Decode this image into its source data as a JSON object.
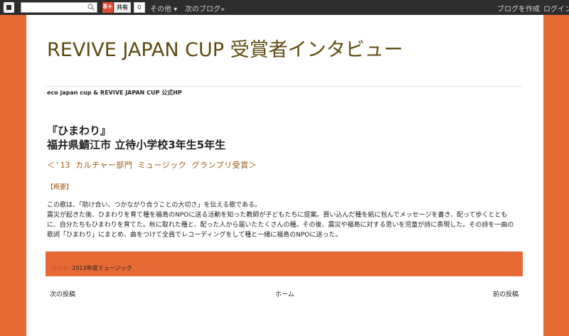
{
  "navbar": {
    "logo_icon": "blogger-icon",
    "search_icon": "search-icon",
    "gplus_label": "8+",
    "share_label": "共有",
    "share_count": "0",
    "more_label": "その他 ▾",
    "next_blog_label": "次のブログ»",
    "create_blog_label": "ブログを作成",
    "login_label": "ログイン"
  },
  "header": {
    "title": "REVIVE JAPAN CUP 受賞者インタビュー",
    "description": "eco japan cup & REVIVE JAPAN CUP 公式HP"
  },
  "post": {
    "title_line1": "『ひまわり』",
    "title_line2": "福井県鯖江市 立待小学校3年生5年生",
    "award": "＜'13 カルチャー部門 ミュージック グランプリ受賞＞",
    "summary_heading": "【概要】",
    "body_lines": [
      "この歌は、「助け合い、つかながり合うことの大切さ」を伝える歌である。",
      "震災が起きた後、ひまわりを育て種を福島のNPOに送る活動を知った教師が子どもたちに提案。買い込んだ種を紙に包んでメッセージを書き、配って歩くととも",
      "に、自分たちもひまわりを育てた。秋に取れた種と、配った人から届いたたくさんの種。その後、震災や福島に対する思いを児童が詩に表現した。その詩を一曲の",
      "歌詞「ひまわり」にまとめ、曲をつけて全員でレコーディングをして種と一緒に福島のNPOに送った。"
    ]
  },
  "labels": {
    "prefix": "ラベル: ",
    "items": [
      "2013年度ミュージック"
    ]
  },
  "pager": {
    "newer": "次の投稿",
    "home": "ホーム",
    "older": "前の投稿"
  },
  "colors": {
    "background": "#e56a35",
    "title": "#5e4a10",
    "accent": "#a05a10",
    "navbar": "#2d2d2d"
  }
}
